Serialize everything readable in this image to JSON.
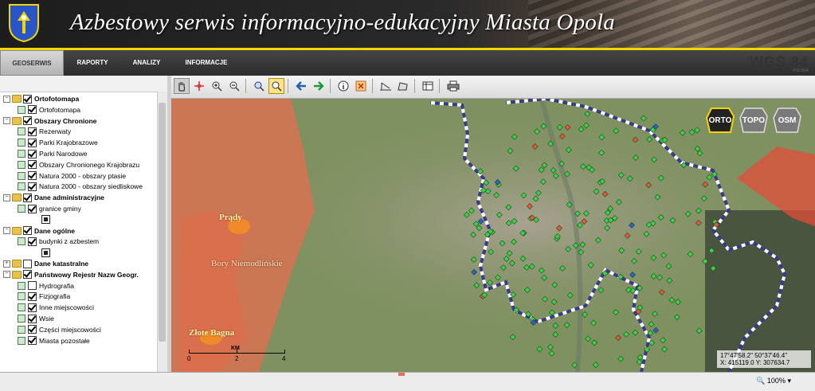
{
  "header": {
    "title": "Azbestowy serwis informacyjno-edukacyjny Miasta Opola"
  },
  "nav": {
    "tabs": [
      {
        "label": "GEOSERWIS"
      },
      {
        "label": "RAPORTY"
      },
      {
        "label": "ANALIZY"
      },
      {
        "label": "INFORMACJE"
      }
    ],
    "brand": "WGS 84",
    "brand_sub": "POLSKA"
  },
  "toolbar": {
    "tools": [
      "pan-icon",
      "move-icon",
      "zoom-in-icon",
      "zoom-out-icon",
      "zoom-extent-icon",
      "zoom-window-icon",
      "back-icon",
      "forward-icon",
      "info-icon",
      "clear-icon",
      "measure-length-icon",
      "measure-area-icon",
      "table-icon",
      "print-icon"
    ]
  },
  "tree": [
    {
      "label": "Ortofotomapa",
      "bold": true,
      "level": 0,
      "checked": true
    },
    {
      "label": "Ortofotomapa",
      "bold": false,
      "level": 1,
      "checked": true
    },
    {
      "label": "Obszary Chronione",
      "bold": true,
      "level": 0,
      "checked": true
    },
    {
      "label": "Rezerwaty",
      "bold": false,
      "level": 1,
      "checked": true
    },
    {
      "label": "Parki Krajobrazowe",
      "bold": false,
      "level": 1,
      "checked": true
    },
    {
      "label": "Parki Narodowe",
      "bold": false,
      "level": 1,
      "checked": true
    },
    {
      "label": "Obszary Chronionego Krajobrazu",
      "bold": false,
      "level": 1,
      "checked": true
    },
    {
      "label": "Natura 2000 - obszary ptasie",
      "bold": false,
      "level": 1,
      "checked": true
    },
    {
      "label": "Natura 2000 - obszary siedliskowe",
      "bold": false,
      "level": 1,
      "checked": true
    },
    {
      "label": "Dane administracyjne",
      "bold": true,
      "level": 0,
      "checked": true
    },
    {
      "label": "granice gminy",
      "bold": false,
      "level": 1,
      "checked": true
    },
    {
      "label": "",
      "bold": false,
      "level": 2,
      "checked": false
    },
    {
      "label": "Dane ogólne",
      "bold": true,
      "level": 0,
      "checked": true
    },
    {
      "label": "budynki z azbestem",
      "bold": false,
      "level": 1,
      "checked": true
    },
    {
      "label": "",
      "bold": false,
      "level": 2,
      "checked": false
    },
    {
      "label": "Dane katastralne",
      "bold": true,
      "level": 0,
      "checked": false
    },
    {
      "label": "Państwowy Rejestr Nazw Geogr.",
      "bold": true,
      "level": 0,
      "checked": true
    },
    {
      "label": "Hydrografia",
      "bold": false,
      "level": 1,
      "checked": false
    },
    {
      "label": "Fizjografia",
      "bold": false,
      "level": 1,
      "checked": true
    },
    {
      "label": "Inne miejscowości",
      "bold": false,
      "level": 1,
      "checked": true
    },
    {
      "label": "Wsie",
      "bold": false,
      "level": 1,
      "checked": true
    },
    {
      "label": "Części miejscowości",
      "bold": false,
      "level": 1,
      "checked": true
    },
    {
      "label": "Miasta pozostałe",
      "bold": false,
      "level": 1,
      "checked": true
    }
  ],
  "map": {
    "layer_buttons": [
      {
        "label": "ORTO"
      },
      {
        "label": "TOPO"
      },
      {
        "label": "OSM"
      }
    ],
    "places": [
      {
        "label": "Prądy"
      },
      {
        "label": "Bory Niemodlińskie"
      },
      {
        "label": "Złote Bagna"
      }
    ],
    "scale": {
      "unit": "KM",
      "ticks": [
        "0",
        "2",
        "4"
      ]
    },
    "coords_line1": "17°47'58.2\" 50°37'46.4\"",
    "coords_line2": "X: 415119.0 Y: 307634.7"
  },
  "status": {
    "zoom": "100%"
  },
  "colors": {
    "accent": "#f3d600",
    "protected_area": "#e0704f",
    "asbestos_marker": "#3fcf4a",
    "boundary": "#3a3a8a"
  }
}
